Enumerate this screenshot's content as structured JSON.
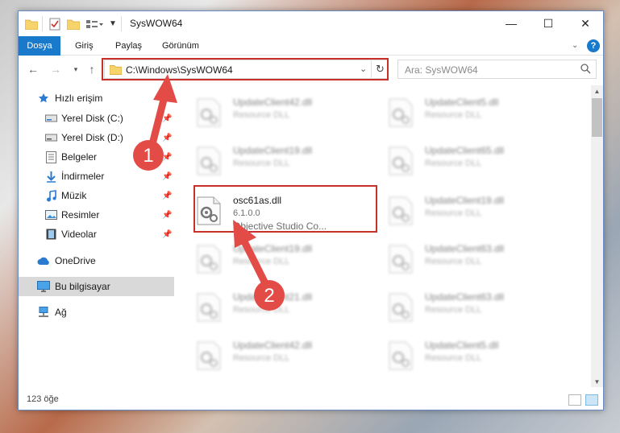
{
  "window": {
    "title": "SysWOW64",
    "controls": {
      "minimize": "—",
      "maximize": "☐",
      "close": "✕"
    }
  },
  "ribbon": {
    "tabs": [
      {
        "label": "Dosya",
        "active": true
      },
      {
        "label": "Giriş"
      },
      {
        "label": "Paylaş"
      },
      {
        "label": "Görünüm"
      }
    ],
    "help_label": "?"
  },
  "nav": {
    "address": "C:\\Windows\\SysWOW64",
    "search_placeholder": "Ara: SysWOW64"
  },
  "sidebar": {
    "items": [
      {
        "label": "Hızlı erişim",
        "icon": "star-icon"
      },
      {
        "label": "Yerel Disk (C:)",
        "icon": "drive-icon",
        "pinned": true
      },
      {
        "label": "Yerel Disk (D:)",
        "icon": "drive-icon",
        "pinned": true
      },
      {
        "label": "Belgeler",
        "icon": "documents-icon",
        "pinned": true
      },
      {
        "label": "İndirmeler",
        "icon": "download-icon",
        "pinned": true
      },
      {
        "label": "Müzik",
        "icon": "music-icon",
        "pinned": true
      },
      {
        "label": "Resimler",
        "icon": "pictures-icon",
        "pinned": true
      },
      {
        "label": "Videolar",
        "icon": "videos-icon",
        "pinned": true
      },
      {
        "label": "OneDrive",
        "icon": "cloud-icon"
      },
      {
        "label": "Bu bilgisayar",
        "icon": "computer-icon",
        "selected": true
      },
      {
        "label": "Ağ",
        "icon": "network-icon"
      }
    ]
  },
  "files": {
    "left": [
      {
        "name": "UpdateClient42.dll",
        "type": "Resource DLL"
      },
      {
        "name": "UpdateClient19.dll",
        "type": "Resource DLL"
      },
      {
        "name": "osc61as.dll",
        "version": "6.1.0.0",
        "company": "Objective Studio Co...",
        "highlighted": true
      },
      {
        "name": "UpdateClient19.dll",
        "type": "Resource DLL"
      },
      {
        "name": "UpdateClient21.dll",
        "type": "Resource DLL"
      },
      {
        "name": "UpdateClient42.dll",
        "type": "Resource DLL"
      }
    ],
    "right": [
      {
        "name": "UpdateClient5.dll",
        "type": "Resource DLL"
      },
      {
        "name": "UpdateClient65.dll",
        "type": "Resource DLL"
      },
      {
        "name": "UpdateClient19.dll",
        "type": "Resource DLL"
      },
      {
        "name": "UpdateClient63.dll",
        "type": "Resource DLL"
      },
      {
        "name": "UpdateClient63.dll",
        "type": "Resource DLL"
      },
      {
        "name": "UpdateClient5.dll",
        "type": "Resource DLL"
      }
    ]
  },
  "status": {
    "item_count": "123 öğe"
  },
  "annotations": {
    "step1": "1",
    "step2": "2"
  },
  "colors": {
    "accent": "#1979ca",
    "annotation": "#c9302c",
    "selected": "#d9d9d9"
  }
}
